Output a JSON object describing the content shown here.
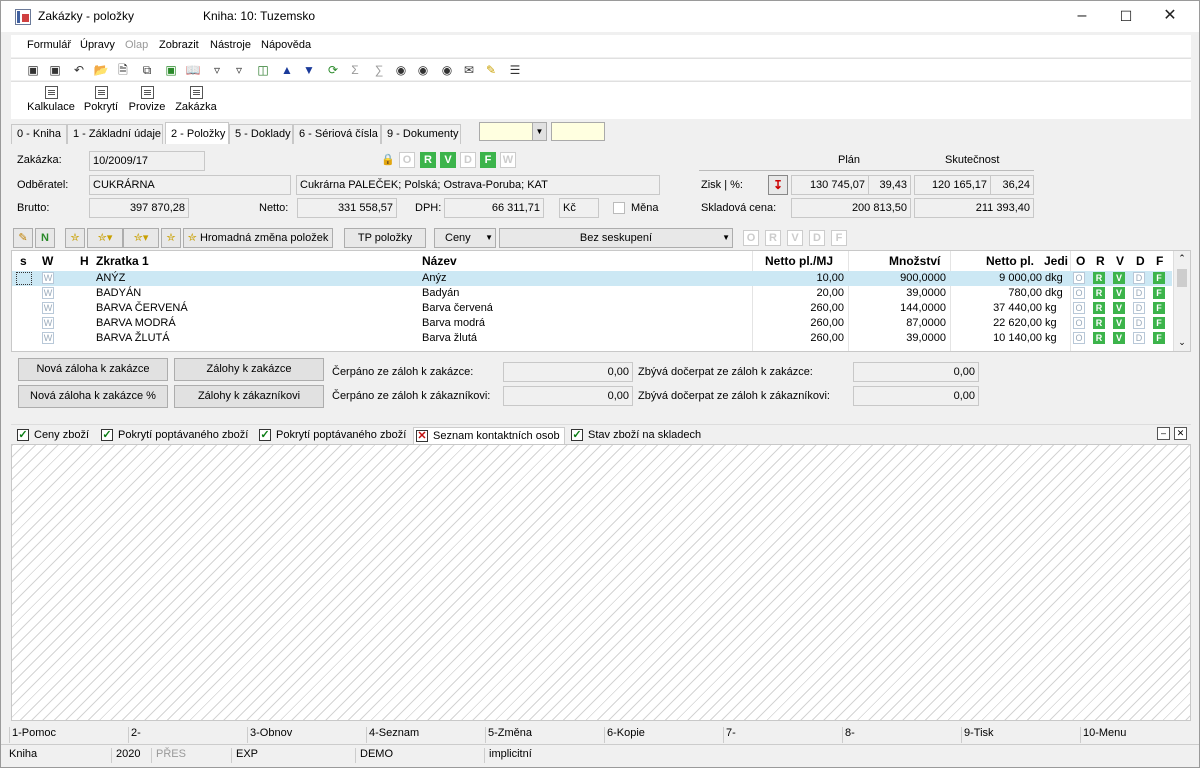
{
  "window": {
    "title": "Zakázky - položky",
    "subtitle": "Kniha: 10: Tuzemsko"
  },
  "menu": [
    "Formulář",
    "Úpravy",
    "Olap",
    "Zobrazit",
    "Nástroje",
    "Nápověda"
  ],
  "big_toolbar": [
    "Kalkulace",
    "Pokrytí",
    "Provize",
    "Zakázka"
  ],
  "tabs": [
    "0 - Kniha",
    "1 - Základní údaje",
    "2 - Položky",
    "5 - Doklady",
    "6 - Sériová čísla",
    "9 - Dokumenty"
  ],
  "header": {
    "zakazka_label": "Zakázka:",
    "zakazka_value": "10/2009/17",
    "odberatel_label": "Odběratel:",
    "odberatel_value": "CUKRÁRNA",
    "odberatel_desc": "Cukrárna PALEČEK; Polská; Ostrava-Poruba; KAT",
    "brutto_label": "Brutto:",
    "brutto_value": "397 870,28",
    "netto_label": "Netto:",
    "netto_value": "331 558,57",
    "dph_label": "DPH:",
    "dph_value": "66 311,71",
    "currency": "Kč",
    "mena_label": "Měna",
    "flags": [
      "O",
      "R",
      "V",
      "D",
      "F",
      "W"
    ],
    "plan_label": "Plán",
    "skutecnost_label": "Skutečnost",
    "zisk_label": "Zisk | %:",
    "zisk_plan": "130 745,07",
    "zisk_plan_pct": "39,43",
    "zisk_skut": "120 165,17",
    "zisk_skut_pct": "36,24",
    "sklad_label": "Skladová cena:",
    "sklad_plan": "200 813,50",
    "sklad_skut": "211 393,40"
  },
  "items_toolbar": {
    "hromadna": "Hromadná změna položek",
    "tp": "TP položky",
    "ceny": "Ceny",
    "seskupeni": "Bez seskupení",
    "flags": [
      "O",
      "R",
      "V",
      "D",
      "F"
    ]
  },
  "grid": {
    "headers": [
      "s",
      "W",
      "H",
      "Zkratka 1",
      "Název",
      "Netto pl./MJ",
      "Množství",
      "Netto pl.",
      "Jedi",
      "O",
      "R",
      "V",
      "D",
      "F"
    ],
    "rows": [
      {
        "zkratka": "ANÝZ",
        "nazev": "Anýz",
        "cena": "10,00",
        "mnozstvi": "900,0000",
        "netto": "9 000,00",
        "jed": "dkg"
      },
      {
        "zkratka": "BADYÁN",
        "nazev": "Badyán",
        "cena": "20,00",
        "mnozstvi": "39,0000",
        "netto": "780,00",
        "jed": "dkg"
      },
      {
        "zkratka": "BARVA ČERVENÁ",
        "nazev": "Barva červená",
        "cena": "260,00",
        "mnozstvi": "144,0000",
        "netto": "37 440,00",
        "jed": "kg"
      },
      {
        "zkratka": "BARVA MODRÁ",
        "nazev": "Barva modrá",
        "cena": "260,00",
        "mnozstvi": "87,0000",
        "netto": "22 620,00",
        "jed": "kg"
      },
      {
        "zkratka": "BARVA ŽLUTÁ",
        "nazev": "Barva žlutá",
        "cena": "260,00",
        "mnozstvi": "39,0000",
        "netto": "10 140,00",
        "jed": "kg"
      }
    ]
  },
  "advances": {
    "btn_nova": "Nová záloha k zakázce",
    "btn_nova_pct": "Nová záloha k zakázce %",
    "btn_zalohy": "Zálohy k zakázce",
    "btn_zalohy_zak": "Zálohy k zákazníkovi",
    "cerpano_zak_label": "Čerpáno ze záloh k zakázce:",
    "cerpano_zak": "0,00",
    "cerpano_zakaznik_label": "Čerpáno ze záloh k zákazníkovi:",
    "cerpano_zakaznik": "0,00",
    "zbyva_zak_label": "Zbývá dočerpat ze záloh k zakázce:",
    "zbyva_zak": "0,00",
    "zbyva_zakaznik_label": "Zbývá dočerpat ze záloh k zákazníkovi:",
    "zbyva_zakaznik": "0,00"
  },
  "bottom_tabs": [
    "Ceny zboží",
    "Pokrytí poptávaného zboží",
    "Pokrytí poptávaného zboží",
    "Seznam kontaktních osob",
    "Stav zboží na skladech"
  ],
  "fkeys": [
    "1-Pomoc",
    "2-",
    "3-Obnov",
    "4-Seznam",
    "5-Změna",
    "6-Kopie",
    "7-",
    "8-",
    "9-Tisk",
    "10-Menu"
  ],
  "status": [
    "Kniha",
    "2020",
    "PŘES",
    "EXP",
    "DEMO",
    "implicitní"
  ]
}
